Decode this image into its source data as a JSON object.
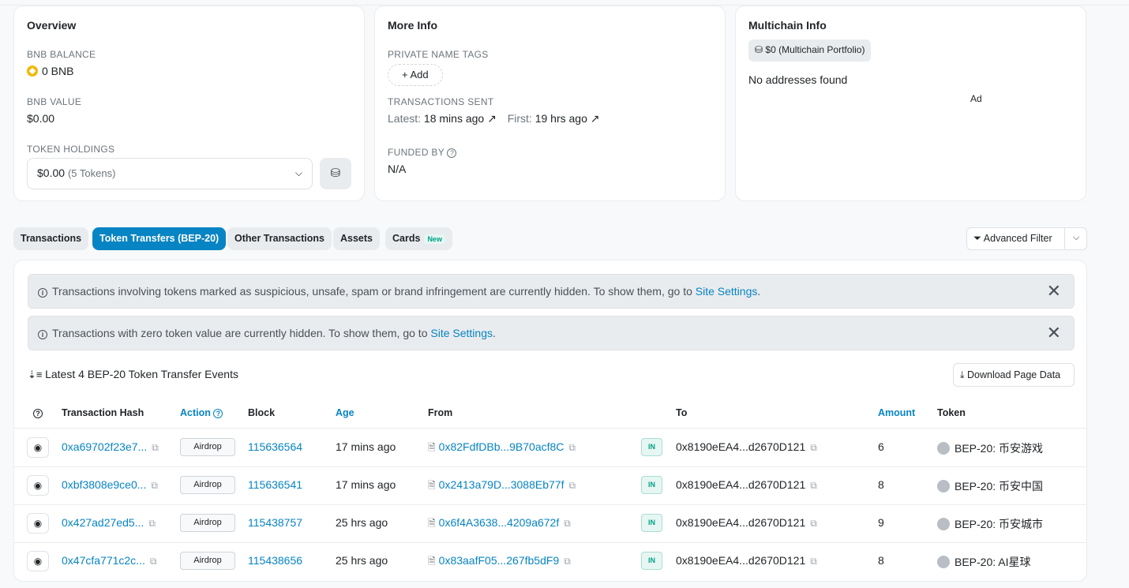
{
  "overview": {
    "title": "Overview",
    "bnb_balance_label": "BNB BALANCE",
    "bnb_balance": "0 BNB",
    "bnb_value_label": "BNB VALUE",
    "bnb_value": "$0.00",
    "token_holdings_label": "TOKEN HOLDINGS",
    "token_holdings_value": "$0.00",
    "token_holdings_count": "(5 Tokens)"
  },
  "more_info": {
    "title": "More Info",
    "private_tags_label": "PRIVATE NAME TAGS",
    "add_label": "+ Add",
    "tx_sent_label": "TRANSACTIONS SENT",
    "latest_prefix": "Latest:",
    "latest_value": "18 mins ago ↗",
    "first_prefix": "First:",
    "first_value": "19 hrs ago ↗",
    "funded_by_label": "FUNDED BY",
    "funded_by_value": "N/A"
  },
  "multichain": {
    "title": "Multichain Info",
    "portfolio": "$0 (Multichain Portfolio)",
    "empty": "No addresses found",
    "ad": "Ad"
  },
  "tabs": [
    {
      "label": "Transactions"
    },
    {
      "label": "Token Transfers (BEP-20)"
    },
    {
      "label": "Other Transactions"
    },
    {
      "label": "Assets"
    },
    {
      "label": "Cards",
      "badge": "New"
    }
  ],
  "advanced_filter": "Advanced Filter",
  "alerts": [
    {
      "text": "Transactions involving tokens marked as suspicious, unsafe, spam or brand infringement are currently hidden. To show them, go to ",
      "link": "Site Settings",
      "end": "."
    },
    {
      "text": "Transactions with zero token value are currently hidden. To show them, go to ",
      "link": "Site Settings",
      "end": "."
    }
  ],
  "list_title": "Latest 4 BEP-20 Token Transfer Events",
  "download": "Download Page Data",
  "columns": {
    "hash": "Transaction Hash",
    "action": "Action",
    "block": "Block",
    "age": "Age",
    "from": "From",
    "to": "To",
    "amount": "Amount",
    "token": "Token"
  },
  "rows": [
    {
      "hash": "0xa69702f23e7...",
      "action": "Airdrop",
      "block": "115636564",
      "age": "17 mins ago",
      "from": "0x82FdfDBb...9B70acf8C",
      "dir": "IN",
      "to": "0x8190eEA4...d2670D121",
      "amount": "6",
      "token": "BEP-20: 币安游戏"
    },
    {
      "hash": "0xbf3808e9ce0...",
      "action": "Airdrop",
      "block": "115636541",
      "age": "17 mins ago",
      "from": "0x2413a79D...3088Eb77f",
      "dir": "IN",
      "to": "0x8190eEA4...d2670D121",
      "amount": "8",
      "token": "BEP-20: 币安中国"
    },
    {
      "hash": "0x427ad27ed5...",
      "action": "Airdrop",
      "block": "115438757",
      "age": "25 hrs ago",
      "from": "0x6f4A3638...4209a672f",
      "dir": "IN",
      "to": "0x8190eEA4...d2670D121",
      "amount": "9",
      "token": "BEP-20: 币安城市"
    },
    {
      "hash": "0x47cfa771c2c...",
      "action": "Airdrop",
      "block": "115438656",
      "age": "25 hrs ago",
      "from": "0x83aafF05...267fb5dF9",
      "dir": "IN",
      "to": "0x8190eEA4...d2670D121",
      "amount": "8",
      "token": "BEP-20: AI星球"
    }
  ]
}
